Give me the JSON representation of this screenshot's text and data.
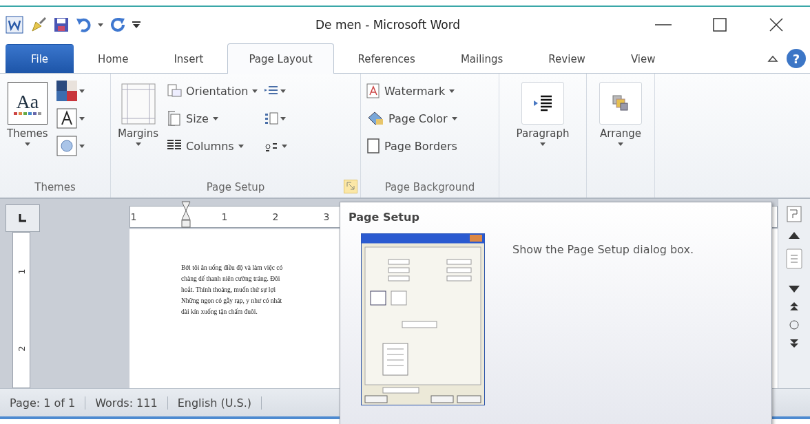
{
  "window": {
    "title": "De men - Microsoft Word"
  },
  "tabs": [
    {
      "label": "File",
      "kind": "file",
      "selected": false
    },
    {
      "label": "Home",
      "kind": "tab",
      "selected": false
    },
    {
      "label": "Insert",
      "kind": "tab",
      "selected": false
    },
    {
      "label": "Page Layout",
      "kind": "tab",
      "selected": true
    },
    {
      "label": "References",
      "kind": "tab",
      "selected": false
    },
    {
      "label": "Mailings",
      "kind": "tab",
      "selected": false
    },
    {
      "label": "Review",
      "kind": "tab",
      "selected": false
    },
    {
      "label": "View",
      "kind": "tab",
      "selected": false
    }
  ],
  "help_button": "?",
  "themes_group": {
    "label": "Themes",
    "themes_button": "Themes",
    "preview": "Aa"
  },
  "page_setup_group": {
    "label": "Page Setup",
    "margins_button": "Margins",
    "commands": [
      "Orientation",
      "Size",
      "Columns"
    ]
  },
  "page_background_group": {
    "label": "Page Background",
    "commands": [
      "Watermark",
      "Page Color",
      "Page Borders"
    ]
  },
  "paragraph_button": "Paragraph",
  "arrange_button": "Arrange",
  "ruler": {
    "horizontal_labels": [
      "1",
      "1",
      "2",
      "3"
    ],
    "vertical_labels": [
      "1",
      "2"
    ]
  },
  "document": {
    "lines": [
      "Bởi tôi ăn uống điều độ và làm việc có",
      "chàng dế thanh niên cường tráng. Đôi",
      "hoắt. Thỉnh thoảng, muốn thử sự lợi",
      "Những ngọn cỏ gẫy rạp, y như có nhát",
      "dài kín xuống tận chấm đuôi."
    ]
  },
  "status_bar": [
    "Page: 1 of 1",
    "Words: 111",
    "English (U.S.)"
  ],
  "tooltip": {
    "title": "Page Setup",
    "description": "Show the Page Setup dialog box."
  }
}
